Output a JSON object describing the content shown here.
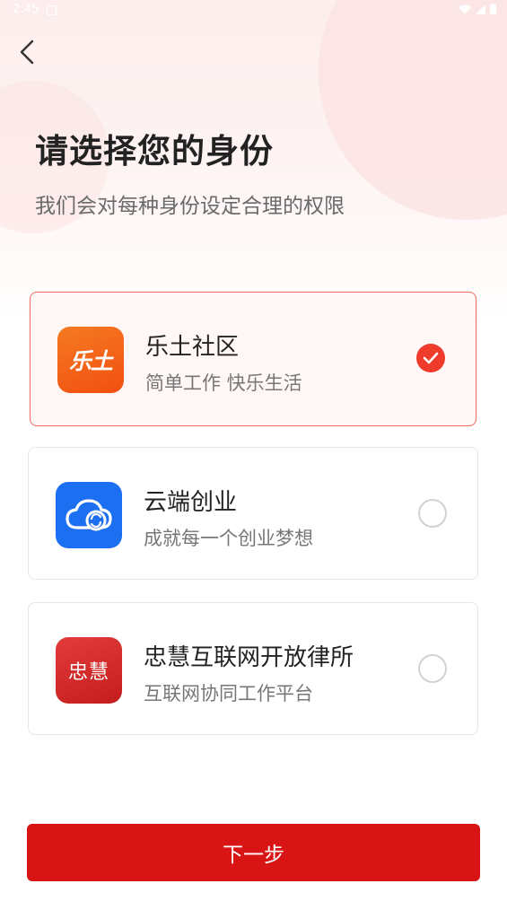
{
  "status_bar": {
    "time": "2:45"
  },
  "header": {
    "title": "请选择您的身份",
    "subtitle": "我们会对每种身份设定合理的权限"
  },
  "identities": [
    {
      "title": "乐土社区",
      "desc": "简单工作 快乐生活",
      "icon_text": "乐土",
      "selected": true
    },
    {
      "title": "云端创业",
      "desc": "成就每一个创业梦想",
      "icon_text": "",
      "selected": false
    },
    {
      "title": "忠慧互联网开放律所",
      "desc": "互联网协同工作平台",
      "icon_text": "忠慧",
      "selected": false
    }
  ],
  "footer": {
    "next_label": "下一步"
  },
  "colors": {
    "accent": "#d81414",
    "check": "#ef3b2c",
    "selected_border": "#ef6a5f",
    "letu_icon": "#f4621a",
    "cloud_icon": "#1d6ff2",
    "zhonghui_icon": "#d42a2a"
  }
}
